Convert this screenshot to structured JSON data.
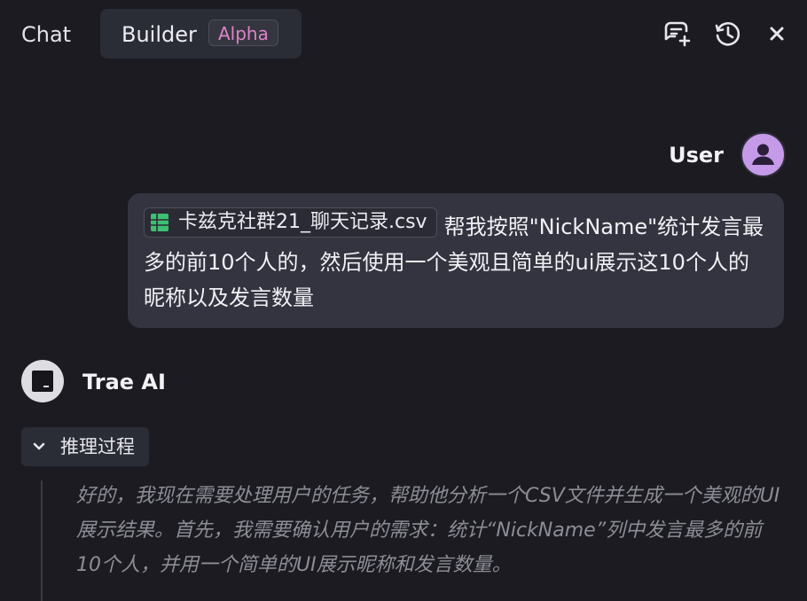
{
  "header": {
    "tabs": [
      {
        "label": "Chat"
      },
      {
        "label": "Builder",
        "badge": "Alpha"
      }
    ],
    "icons": [
      "new-chat-icon",
      "history-icon",
      "close-icon"
    ]
  },
  "user_message": {
    "author": "User",
    "attachment": "卡兹克社群21_聊天记录.csv",
    "text": "帮我按照\"NickName\"统计发言最多的前10个人的，然后使用一个美观且简单的ui展示这10个人的昵称以及发言数量"
  },
  "ai_message": {
    "author": "Trae AI",
    "reasoning_label": "推理过程",
    "reasoning_text": "好的，我现在需要处理用户的任务，帮助他分析一个CSV文件并生成一个美观的UI展示结果。首先，我需要确认用户的需求：统计“NickName”列中发言最多的前10个人，并用一个简单的UI展示昵称和发言数量。"
  },
  "colors": {
    "background": "#1b1b21",
    "bubble": "#33343f",
    "badge_text": "#dc84c8",
    "user_avatar": "#c59ae8",
    "csv_icon": "#3fbf74"
  }
}
